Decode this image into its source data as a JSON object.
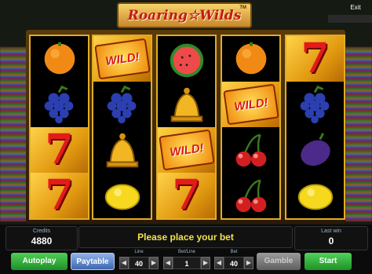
{
  "game": {
    "title": "Roaring☆Wilds",
    "trademark": "TM",
    "exit_label": "Exit"
  },
  "wild_label": "WILD!",
  "seven_label": "7",
  "reels": [
    [
      "orange",
      "grapes",
      "seven",
      "seven"
    ],
    [
      "wild",
      "grapes",
      "bell",
      "lemon"
    ],
    [
      "watermelon",
      "bell",
      "wild",
      "seven"
    ],
    [
      "orange",
      "wild",
      "cherries",
      "cherries"
    ],
    [
      "seven",
      "grapes",
      "plum",
      "lemon"
    ]
  ],
  "panel": {
    "credits_label": "Credits",
    "credits_value": "4880",
    "message": "Please place your bet",
    "last_win_label": "Last win",
    "last_win_value": "0"
  },
  "controls": {
    "autoplay_label": "Autoplay",
    "paytable_label": "Paytable",
    "line_label": "Line",
    "line_value": "40",
    "bet_line_label": "Bet/Line",
    "bet_line_value": "1",
    "bet_label": "Bet",
    "bet_value": "40",
    "gamble_label": "Gamble",
    "start_label": "Start"
  },
  "colors": {
    "reel_border": "#e1ad22",
    "start_green": "#1e9126",
    "message_yellow": "#f5e24b",
    "title_red": "#c21a1a"
  }
}
